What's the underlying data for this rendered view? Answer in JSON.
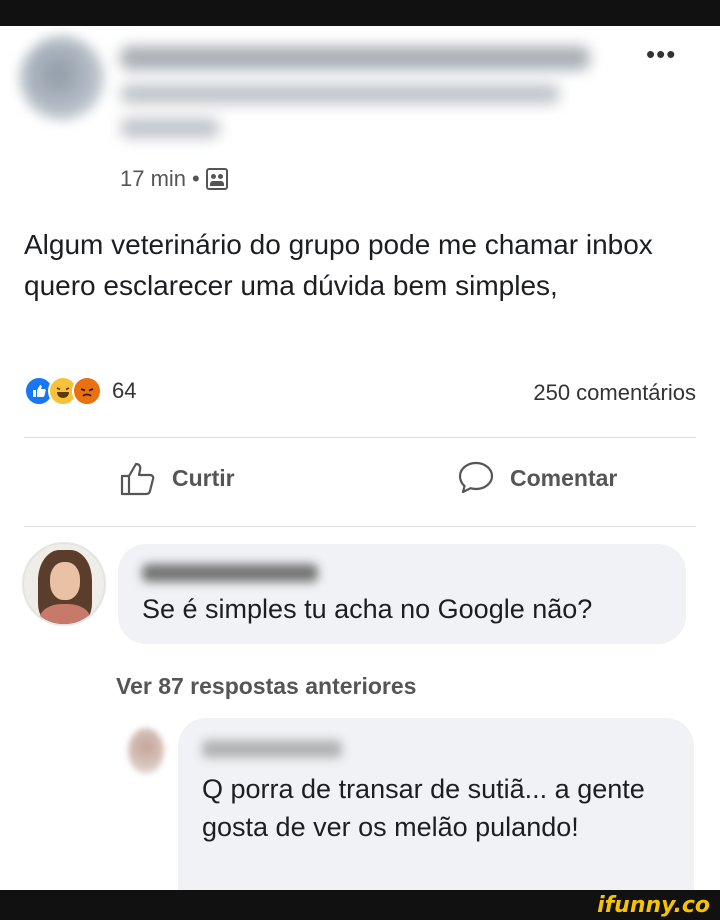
{
  "post": {
    "time": "17 min",
    "separator": "•",
    "text": "Algum veterinário do grupo pode me chamar inbox quero esclarecer uma dúvida bem simples,",
    "reaction_count": "64",
    "comment_count": "250 comentários",
    "more_icon": "more-options-icon",
    "audience_icon": "group-audience-icon"
  },
  "actions": {
    "like_label": "Curtir",
    "comment_label": "Comentar"
  },
  "comments": [
    {
      "text": "Se é simples tu acha no Google não?"
    },
    {
      "text": "Q porra de transar de sutiã... a gente gosta de ver os melão pulando!"
    }
  ],
  "more_replies_label": "Ver 87 respostas anteriores",
  "watermark": "ifunny.co",
  "colors": {
    "like_blue": "#1877f2",
    "haha_yellow": "#f7c13a",
    "angry_orange": "#e9710f",
    "bubble_bg": "#f0f2f5"
  }
}
